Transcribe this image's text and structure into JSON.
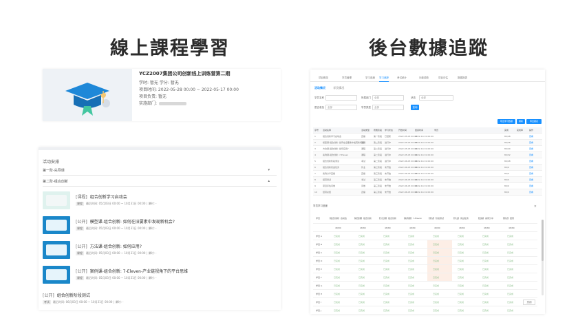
{
  "headings": {
    "left": "線上課程學習",
    "right": "後台數據追蹤"
  },
  "course": {
    "title": "YCZ2007集团公司创新线上训练营第二期",
    "credits": "学时: 暂无    学分: 暂无",
    "time": "项目时间:  2022-05-28 00:00 ~ 2022-05-17 00:00",
    "owner": "项目负责:  暂无",
    "dept": "实施部门:"
  },
  "activity_list": {
    "header": "活动安排",
    "stage1": "第一阶-先导课",
    "stage2": "第二阶-组合创新",
    "lessons": [
      {
        "tag": "[课程]",
        "title": "组合创新学习启动会",
        "badge": "课程",
        "meta": "最后时间: 05月03日 00:00 ~ 10月31日 00:00  |  课时: -"
      },
      {
        "tag": "[公开]",
        "title": "模型课-组合创新: 如何在旧要素中发现新机会?",
        "badge": "课程",
        "meta": "最后时间: 05月03日 00:00 ~ 10月31日 00:00  |  课时: -"
      },
      {
        "tag": "[公开]",
        "title": "方法课-组合创新: 如何应用?",
        "badge": "课程",
        "meta": "最后时间: 05月03日 00:00 ~ 10月31日 00:00  |  课时: -"
      },
      {
        "tag": "[公开]",
        "title": "案例课-组合创新: 7-Eleven-产业链视角下的平台思维",
        "badge": "课程",
        "meta": "最后时间: 05月03日 00:00 ~ 10月31日 00:00  |  课时: -"
      }
    ],
    "final": {
      "tag": "[公开]",
      "title": "组合创新阶段测试",
      "badge": "考试",
      "meta": "最后时间: 06月03日 00:00 ~ 10月31日 00:00  |  课时: -"
    }
  },
  "admin": {
    "tabs": [
      "项目概览",
      "学员管理",
      "学习进度",
      "学习追踪",
      "考试统计",
      "问卷调查",
      "项目评估",
      "数据报表"
    ],
    "active_tab_index": 3,
    "sub_tabs": [
      "活动情况",
      "学员情况"
    ],
    "filters": {
      "name_label": "学员名称",
      "dept_label": "所属部门",
      "dept_value": "全部",
      "status_label": "状态",
      "status_value": "全部",
      "join_label": "是否参加",
      "join_value": "全部",
      "type_label": "学员类型",
      "type_value": "全部",
      "search_label": "查询"
    },
    "action_buttons": [
      "导出学习数据",
      "刷新",
      "导出报表"
    ],
    "table_headers": [
      "序号",
      "活动名称",
      "活动类型",
      "所属阶段",
      "学习状态",
      "开始时间",
      "结束时间",
      "学员",
      "完成",
      "完成率",
      "操作"
    ],
    "table_rows": [
      [
        "1",
        "组合创新学习启动会",
        "直播",
        "第一阶段",
        "已结束",
        "2022-05-03 00:00",
        "2022-10-31 00:00",
        "80/48",
        "查看"
      ],
      [
        "2",
        "模型课-组合创新: 如何在旧要素中发现新机会?",
        "课程",
        "第二阶段",
        "进行中",
        "2022-05-03 00:00",
        "2022-10-31 00:00",
        "80/36",
        "查看"
      ],
      [
        "3",
        "方法课-组合创新: 如何应用?",
        "课程",
        "第二阶段",
        "进行中",
        "2022-05-03 00:00",
        "2022-10-31 00:00",
        "80/40",
        "查看"
      ],
      [
        "4",
        "案例课-组合创新: 7-Eleven",
        "课程",
        "第二阶段",
        "进行中",
        "2022-05-03 00:00",
        "2022-10-31 00:00",
        "80/32",
        "查看"
      ],
      [
        "5",
        "组合创新阶段测试",
        "考试",
        "第二阶段",
        "进行中",
        "2022-06-03 00:00",
        "2022-10-31 00:00",
        "80/28",
        "查看"
      ],
      [
        "6",
        "组合创新实战任务",
        "作业",
        "第三阶段",
        "未开始",
        "2022-06-03 00:00",
        "2022-10-31 00:00",
        "80/0",
        "查看"
      ],
      [
        "7",
        "案例分享直播",
        "直播",
        "第三阶段",
        "未开始",
        "2022-06-03 00:00",
        "2022-10-31 00:00",
        "80/0",
        "查看"
      ],
      [
        "8",
        "结营测试",
        "考试",
        "第三阶段",
        "未开始",
        "2022-06-03 00:00",
        "2022-10-31 00:00",
        "80/0",
        "查看"
      ],
      [
        "9",
        "项目评估问卷",
        "问卷",
        "第三阶段",
        "未开始",
        "2022-06-03 00:00",
        "2022-10-31 00:00",
        "80/0",
        "查看"
      ],
      [
        "10",
        "结营总结",
        "直播",
        "第三阶段",
        "未开始",
        "2022-06-03 00:00",
        "2022-10-31 00:00",
        "80/0",
        "查看"
      ]
    ],
    "modal": {
      "title": "学员学习进度",
      "col_headers": [
        "学员",
        "【组合创新】启动会",
        "【模型课】组合创新",
        "【方法课】组合创新",
        "【案例课】7-Eleven",
        "【测试】阶段测试",
        "【作业】实战任务",
        "【直播】案例分享",
        "【测试】结营"
      ],
      "sub_header": "48/80",
      "rows": [
        "学员 A",
        "学员 B",
        "学员 C",
        "学员 D",
        "学员 E",
        "学员 F",
        "学员 G",
        "学员 H",
        "学员 I",
        "学员 J"
      ],
      "cell_value": "已完成",
      "close_label": "关闭"
    }
  }
}
